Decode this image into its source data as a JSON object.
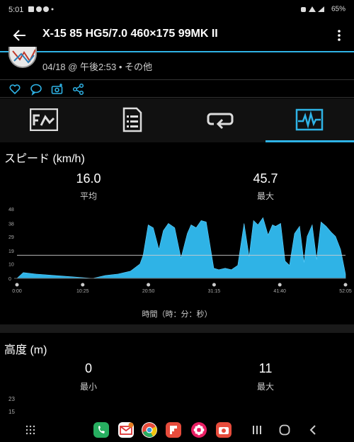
{
  "status": {
    "time": "5:01",
    "battery": "65%"
  },
  "app_bar": {
    "title": "X-15 85 HG5/7.0 460×175 99MK II"
  },
  "activity": {
    "date": "04/18 @ 午後2:53 • その他"
  },
  "speed": {
    "title": "スピード (km/h)",
    "avg_value": "16.0",
    "avg_label": "平均",
    "max_value": "45.7",
    "max_label": "最大"
  },
  "elevation": {
    "title": "高度 (m)",
    "min_value": "0",
    "min_label": "最小",
    "max_value": "11",
    "max_label": "最大",
    "y_ticks": [
      "23",
      "15"
    ]
  },
  "chart_data": {
    "type": "area",
    "xlabel": "時間（時：分：秒）",
    "y_ticks": [
      48,
      38,
      29,
      19,
      10,
      0
    ],
    "x_ticks": [
      "0:00",
      "10:25",
      "20:50",
      "31:15",
      "41:40",
      "52:05"
    ],
    "ylim": [
      0,
      48
    ],
    "xlim": [
      0,
      52.08
    ],
    "average_line": 16.0,
    "color": "#2fb3e6",
    "x": [
      0,
      1,
      3,
      6,
      9,
      12,
      14,
      16,
      18,
      19.5,
      20,
      20.8,
      21.6,
      22.5,
      23.2,
      24.0,
      25.0,
      26.0,
      27.0,
      27.6,
      28.4,
      29.2,
      30,
      31.2,
      32,
      33,
      34,
      35,
      36.0,
      36.8,
      37.5,
      38.2,
      39.0,
      39.8,
      40.5,
      41.0,
      41.8,
      42.5,
      43.2,
      44.0,
      44.8,
      45.5,
      46.0,
      46.8,
      47.5,
      48.2,
      49.0,
      49.8,
      50.5,
      51.3,
      52.08
    ],
    "y": [
      0,
      4,
      3,
      2,
      1,
      0,
      2,
      3,
      5,
      10,
      16,
      37,
      35,
      20,
      33,
      38,
      35,
      14,
      31,
      37,
      35,
      40,
      39,
      7,
      6,
      7,
      6,
      9,
      38,
      15,
      40,
      37,
      42,
      30,
      37,
      36,
      38,
      12,
      9,
      31,
      36,
      11,
      29,
      37,
      13,
      39,
      36,
      32,
      29,
      20,
      3
    ]
  }
}
